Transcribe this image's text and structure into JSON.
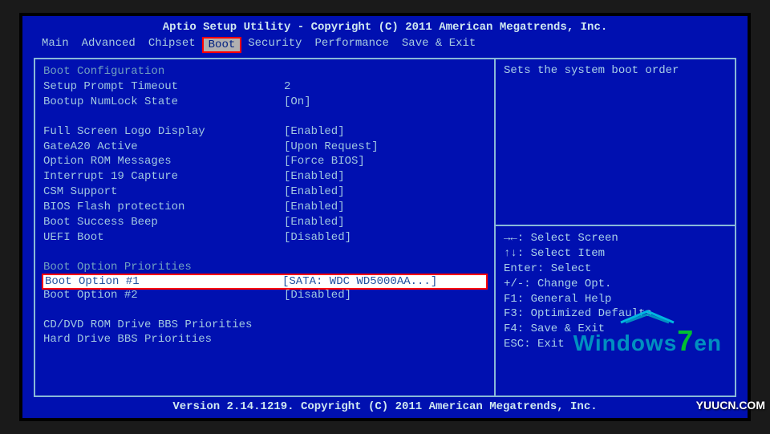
{
  "title": "Aptio Setup Utility - Copyright (C) 2011 American Megatrends, Inc.",
  "footer": "Version 2.14.1219. Copyright (C) 2011 American Megatrends, Inc.",
  "menu": {
    "items": [
      "Main",
      "Advanced",
      "Chipset",
      "Boot",
      "Security",
      "Performance",
      "Save & Exit"
    ],
    "active_index": 3
  },
  "sections": {
    "boot_config_header": "Boot Configuration",
    "boot_priorities_header": "Boot Option Priorities"
  },
  "fields": [
    {
      "label": "Setup Prompt Timeout",
      "value": "2"
    },
    {
      "label": "Bootup NumLock State",
      "value": "[On]"
    }
  ],
  "fields2": [
    {
      "label": "Full Screen Logo Display",
      "value": "[Enabled]"
    },
    {
      "label": "GateA20 Active",
      "value": "[Upon Request]"
    },
    {
      "label": "Option ROM Messages",
      "value": "[Force BIOS]"
    },
    {
      "label": "Interrupt 19 Capture",
      "value": "[Enabled]"
    },
    {
      "label": "CSM Support",
      "value": "[Enabled]"
    },
    {
      "label": "BIOS Flash protection",
      "value": "[Enabled]"
    },
    {
      "label": "Boot Success Beep",
      "value": "[Enabled]"
    },
    {
      "label": "UEFI Boot",
      "value": "[Disabled]"
    }
  ],
  "boot_options": [
    {
      "label": "Boot Option #1",
      "value": "[SATA: WDC WD5000AA...]",
      "selected": true
    },
    {
      "label": "Boot Option #2",
      "value": "[Disabled]",
      "selected": false
    }
  ],
  "submenus": [
    "CD/DVD ROM Drive BBS Priorities",
    "Hard Drive BBS Priorities"
  ],
  "help": {
    "description": "Sets the system boot order",
    "keys": [
      "→←: Select Screen",
      "↑↓: Select Item",
      "Enter: Select",
      "+/-: Change Opt.",
      "F1: General Help",
      "F3: Optimized Defaults",
      "F4: Save & Exit",
      "ESC: Exit"
    ]
  },
  "watermark": {
    "text_a": "Windows",
    "text_b": "7",
    "text_c": "en",
    "corner": "YUUCN.COM"
  }
}
